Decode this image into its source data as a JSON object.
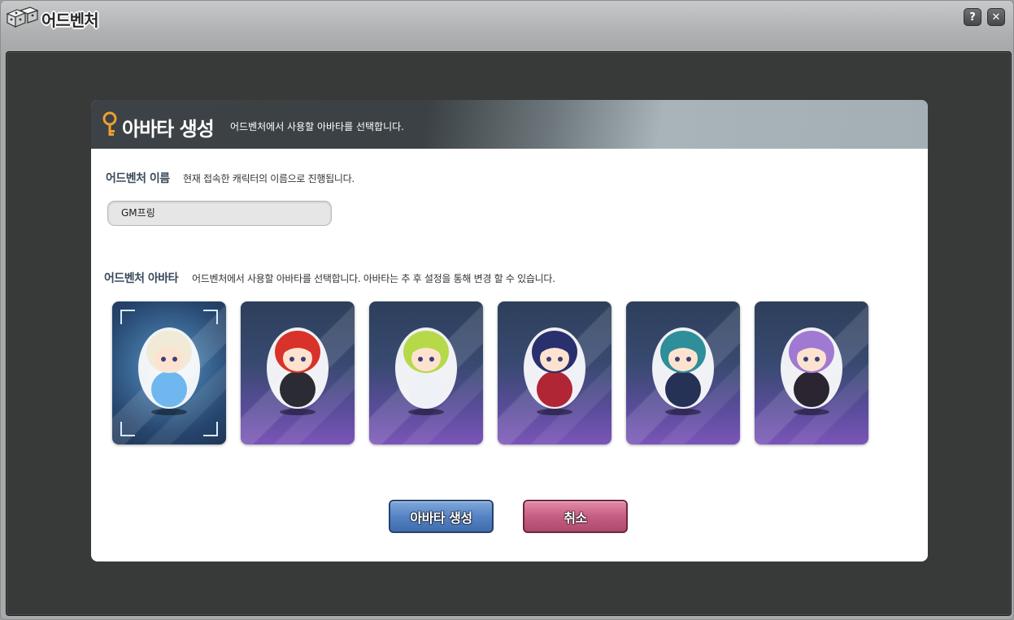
{
  "window": {
    "title": "어드벤처",
    "help_label": "?",
    "close_label": "✕"
  },
  "panel": {
    "title": "아바타 생성",
    "subtitle": "어드벤처에서 사용할 아바타를 선택합니다."
  },
  "name_section": {
    "label": "어드벤처 이름",
    "description": "현재 접속한 캐릭터의 이름으로 진행됩니다.",
    "value": "GM프링"
  },
  "avatar_section": {
    "label": "어드벤처 아바타",
    "description": "어드벤처에서 사용할 아바타를 선택합니다. 아바타는 추 후 설정을 통해 변경 할 수 있습니다.",
    "selected_index": 0,
    "avatars": [
      {
        "icon": "white-haired-princess-avatar",
        "hair": "#f1ead6",
        "outfit": "#6fb7ef"
      },
      {
        "icon": "red-haired-suit-avatar",
        "hair": "#d8322a",
        "outfit": "#2b2b33"
      },
      {
        "icon": "green-haired-cat-avatar",
        "hair": "#b6d94a",
        "outfit": "#eef1f5"
      },
      {
        "icon": "navy-haired-bear-avatar",
        "hair": "#2a2f6e",
        "outfit": "#b02635"
      },
      {
        "icon": "teal-haired-cake-avatar",
        "hair": "#2e8e9a",
        "outfit": "#263255"
      },
      {
        "icon": "purple-haired-tophat-avatar",
        "hair": "#a07ad2",
        "outfit": "#2a2530"
      }
    ]
  },
  "buttons": {
    "create_label": "아바타 생성",
    "cancel_label": "취소"
  },
  "colors": {
    "header_dark": "#3b4144",
    "header_light": "#a3afb4",
    "create_button": "#5683c4",
    "cancel_button": "#c75d82",
    "frame": "#373a39"
  }
}
